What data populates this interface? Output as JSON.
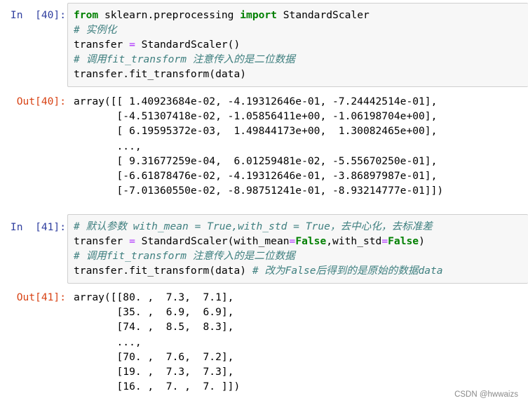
{
  "cells": [
    {
      "in_prompt": "In  [40]:",
      "code": {
        "l1_from": "from",
        "l1_module": " sklearn.preprocessing ",
        "l1_import": "import",
        "l1_name": " StandardScaler",
        "l2_comment": "# 实例化",
        "l3_var": "transfer ",
        "l3_eq": "=",
        "l3_rest": " StandardScaler()",
        "l4_comment": "# 调用fit_transform 注意传入的是二位数据",
        "l5_call": "transfer.fit_transform(data)"
      },
      "out_prompt": "Out[40]:",
      "output_lines": [
        "array([[ 1.40923684e-02, -4.19312646e-01, -7.24442514e-01],",
        "       [-4.51307418e-02, -1.05856411e+00, -1.06198704e+00],",
        "       [ 6.19595372e-03,  1.49844173e+00,  1.30082465e+00],",
        "       ...,",
        "       [ 9.31677259e-04,  6.01259481e-02, -5.55670250e-01],",
        "       [-6.61878476e-02, -4.19312646e-01, -3.86897987e-01],",
        "       [-7.01360550e-02, -8.98751241e-01, -8.93214777e-01]])"
      ]
    },
    {
      "in_prompt": "In  [41]:",
      "code": {
        "l1_comment": "# 默认参数 with_mean = True,with_std = True，去中心化，去标准差",
        "l2_var": "transfer ",
        "l2_eq": "=",
        "l2_call": " StandardScaler(with_mean",
        "l2_eq2": "=",
        "l2_false1": "False",
        "l2_mid": ",with_std",
        "l2_eq3": "=",
        "l2_false2": "False",
        "l2_close": ")",
        "l3_comment": "# 调用fit_transform 注意传入的是二位数据",
        "l4_call": "transfer.fit_transform(data) ",
        "l4_comment": "# 改为False后得到的是原始的数据data"
      },
      "out_prompt": "Out[41]:",
      "output_lines": [
        "array([[80. ,  7.3,  7.1],",
        "       [35. ,  6.9,  6.9],",
        "       [74. ,  8.5,  8.3],",
        "       ...,",
        "       [70. ,  7.6,  7.2],",
        "       [19. ,  7.3,  7.3],",
        "       [16. ,  7. ,  7. ]])"
      ]
    }
  ],
  "watermark": "CSDN @hwwaizs",
  "colors": {
    "in_prompt": "#303F9F",
    "out_prompt": "#D84315",
    "keyword": "#008000",
    "comment": "#408080",
    "operator": "#AA22FF",
    "input_bg": "#f7f7f7"
  }
}
